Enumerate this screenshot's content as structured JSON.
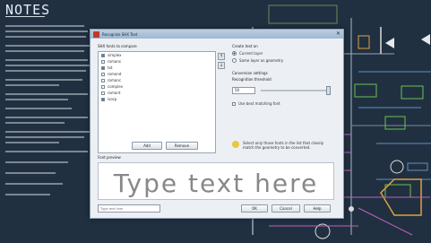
{
  "drawing": {
    "notes_title": "NOTES"
  },
  "dialog": {
    "title": "Recognize SHX Text",
    "fonts_label": "SHX fonts to compare",
    "fonts": [
      {
        "name": "simplex",
        "checked": true
      },
      {
        "name": "romans",
        "checked": false
      },
      {
        "name": "txt",
        "checked": true
      },
      {
        "name": "romand",
        "checked": false
      },
      {
        "name": "romanc",
        "checked": false
      },
      {
        "name": "complex",
        "checked": false
      },
      {
        "name": "romant",
        "checked": false
      },
      {
        "name": "isocp",
        "checked": true
      }
    ],
    "add_button": "Add",
    "remove_button": "Remove",
    "create_label": "Create text on",
    "radio_options": [
      {
        "label": "Current layer",
        "selected": true
      },
      {
        "label": "Same layer as geometry",
        "selected": false
      }
    ],
    "conversion_label": "Conversion settings",
    "threshold_label": "Recognition threshold",
    "threshold_value": "50",
    "checkbox_label": "Use best matching font",
    "hint_text": "Select only those fonts in the list that closely match the geometry to be converted.",
    "preview_label": "Font preview",
    "preview_text": "Type text here",
    "preview_input_placeholder": "Type text here",
    "ok_button": "OK",
    "cancel_button": "Cancel",
    "help_button": "Help"
  }
}
